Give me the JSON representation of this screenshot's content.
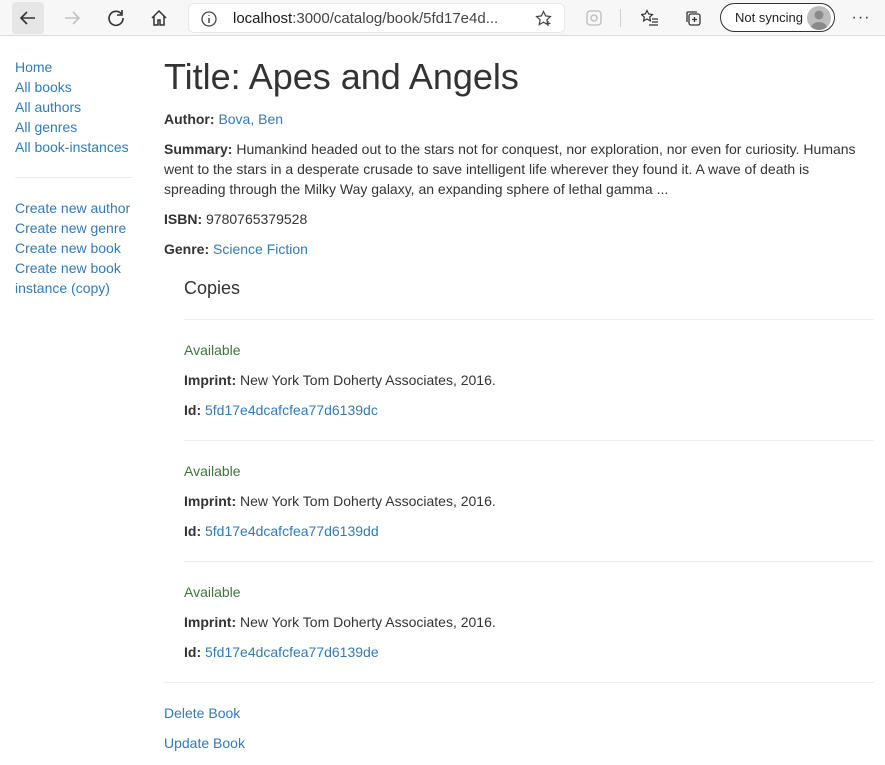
{
  "browser": {
    "url_host": "localhost",
    "url_rest": ":3000/catalog/book/5fd17e4d...",
    "sync_label": "Not syncing",
    "menu_glyph": "···"
  },
  "sidebar": {
    "nav": [
      "Home",
      "All books",
      "All authors",
      "All genres",
      "All book-instances"
    ],
    "create": [
      "Create new author",
      "Create new genre",
      "Create new book",
      "Create new book instance (copy)"
    ]
  },
  "book": {
    "title": "Title: Apes and Angels",
    "author_label": "Author:",
    "author": "Bova, Ben",
    "summary_label": "Summary:",
    "summary": "Humankind headed out to the stars not for conquest, nor exploration, nor even for curiosity. Humans went to the stars in a desperate crusade to save intelligent life wherever they found it. A wave of death is spreading through the Milky Way galaxy, an expanding sphere of lethal gamma ...",
    "isbn_label": "ISBN:",
    "isbn": "9780765379528",
    "genre_label": "Genre:",
    "genre": "Science Fiction"
  },
  "copies": {
    "heading": "Copies",
    "imprint_label": "Imprint:",
    "id_label": "Id:",
    "items": [
      {
        "status": "Available",
        "imprint": "New York Tom Doherty Associates, 2016.",
        "id": "5fd17e4dcafcfea77d6139dc"
      },
      {
        "status": "Available",
        "imprint": "New York Tom Doherty Associates, 2016.",
        "id": "5fd17e4dcafcfea77d6139dd"
      },
      {
        "status": "Available",
        "imprint": "New York Tom Doherty Associates, 2016.",
        "id": "5fd17e4dcafcfea77d6139de"
      }
    ]
  },
  "actions": {
    "delete": "Delete Book",
    "update": "Update Book"
  },
  "colors": {
    "link": "#337ab7",
    "available": "#3c763d"
  }
}
